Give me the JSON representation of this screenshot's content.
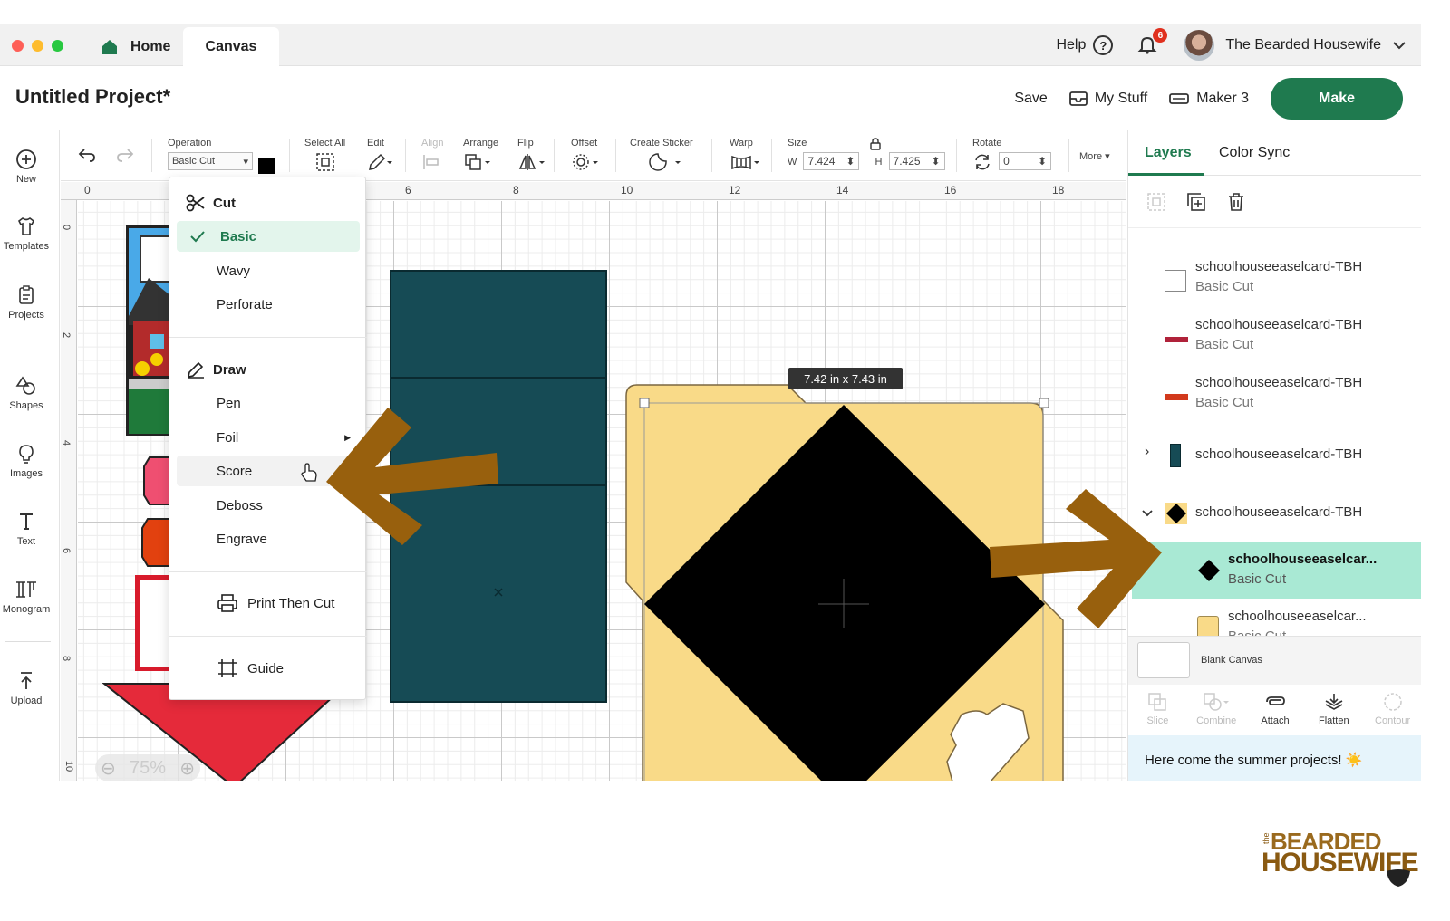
{
  "tabbar": {
    "home_label": "Home",
    "canvas_label": "Canvas",
    "help_label": "Help",
    "notification_count": "6",
    "user_name": "The Bearded Housewife"
  },
  "project": {
    "title": "Untitled Project*",
    "save_label": "Save",
    "mystuff_label": "My Stuff",
    "machine_label": "Maker 3",
    "make_label": "Make"
  },
  "sidebar": {
    "items": [
      {
        "label": "New",
        "icon": "plus-circle-icon"
      },
      {
        "label": "Templates",
        "icon": "shirt-icon"
      },
      {
        "label": "Projects",
        "icon": "clipboard-icon"
      },
      {
        "label": "Shapes",
        "icon": "shapes-icon"
      },
      {
        "label": "Images",
        "icon": "lightbulb-icon"
      },
      {
        "label": "Text",
        "icon": "text-icon"
      },
      {
        "label": "Monogram",
        "icon": "monogram-icon"
      },
      {
        "label": "Upload",
        "icon": "upload-icon"
      }
    ]
  },
  "toolbar": {
    "operation_label": "Operation",
    "operation_value": "Basic Cut",
    "select_all_label": "Select All",
    "edit_label": "Edit",
    "align_label": "Align",
    "arrange_label": "Arrange",
    "flip_label": "Flip",
    "offset_label": "Offset",
    "create_sticker_label": "Create Sticker",
    "warp_label": "Warp",
    "size_label": "Size",
    "width_prefix": "W",
    "width_value": "7.424",
    "height_prefix": "H",
    "height_value": "7.425",
    "rotate_label": "Rotate",
    "rotate_value": "0",
    "more_label": "More"
  },
  "ruler": {
    "top_ticks": [
      "0",
      "6",
      "8",
      "10",
      "12",
      "14",
      "16",
      "18"
    ],
    "left_ticks": [
      "0",
      "2",
      "4",
      "6",
      "8",
      "10"
    ]
  },
  "canvas": {
    "size_tooltip": "7.42  in x 7.43  in",
    "zoom_label": "75%"
  },
  "operation_menu": {
    "cut_header": "Cut",
    "cut_options": [
      "Basic",
      "Wavy",
      "Perforate"
    ],
    "selected_option": "Basic",
    "draw_header": "Draw",
    "draw_options": [
      "Pen",
      "Foil",
      "Score",
      "Deboss",
      "Engrave"
    ],
    "hovered_option": "Score",
    "print_then_cut": "Print Then Cut",
    "guide": "Guide"
  },
  "layers_panel": {
    "tabs": [
      "Layers",
      "Color Sync"
    ],
    "active_tab": "Layers",
    "layers": [
      {
        "name": "schoolhouseeaselcard-TBH",
        "type": "Basic Cut"
      },
      {
        "name": "schoolhouseeaselcard-TBH",
        "type": "Basic Cut"
      },
      {
        "name": "schoolhouseeaselcard-TBH",
        "type": "Basic Cut"
      },
      {
        "name": "schoolhouseeaselcard-TBH",
        "type": ""
      },
      {
        "name": "schoolhouseeaselcard-TBH",
        "type": ""
      },
      {
        "name": "schoolhouseeaselcar...",
        "type": "Basic Cut"
      },
      {
        "name": "schoolhouseeaselcar...",
        "type": "Basic Cut"
      }
    ],
    "blank_canvas_label": "Blank Canvas",
    "actions": [
      "Slice",
      "Combine",
      "Attach",
      "Flatten",
      "Contour"
    ],
    "banner_text": "Here come the summer projects! ☀️"
  },
  "watermark": {
    "line_small": "the",
    "line1": "BEARDED",
    "line2": "HOUSEWIFE"
  },
  "colors": {
    "accent": "#1f7a4f",
    "selection": "#a9e9d4",
    "arrow": "#98600d",
    "teal_panel": "#164b55",
    "tan_card": "#f9da88"
  }
}
